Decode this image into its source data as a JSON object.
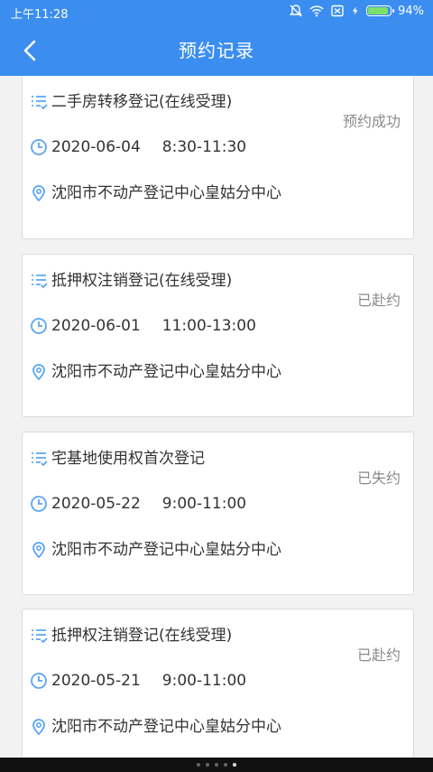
{
  "statusbar": {
    "time": "上午11:28",
    "battery": "94%"
  },
  "header": {
    "title": "预约记录"
  },
  "records": [
    {
      "service": "二手房转移登记(在线受理)",
      "date": "2020-06-04",
      "time": "8:30-11:30",
      "location": "沈阳市不动产登记中心皇姑分中心",
      "status": "预约成功"
    },
    {
      "service": "抵押权注销登记(在线受理)",
      "date": "2020-06-01",
      "time": "11:00-13:00",
      "location": "沈阳市不动产登记中心皇姑分中心",
      "status": "已赴约"
    },
    {
      "service": "宅基地使用权首次登记",
      "date": "2020-05-22",
      "time": "9:00-11:00",
      "location": "沈阳市不动产登记中心皇姑分中心",
      "status": "已失约"
    },
    {
      "service": "抵押权注销登记(在线受理)",
      "date": "2020-05-21",
      "time": "9:00-11:00",
      "location": "沈阳市不动产登记中心皇姑分中心",
      "status": "已赴约"
    }
  ],
  "colors": {
    "primary": "#3b8ef0",
    "icon": "#5aa6f2",
    "status_text": "#8a8a8a"
  },
  "nav": {
    "dots": 5,
    "active": 4
  }
}
